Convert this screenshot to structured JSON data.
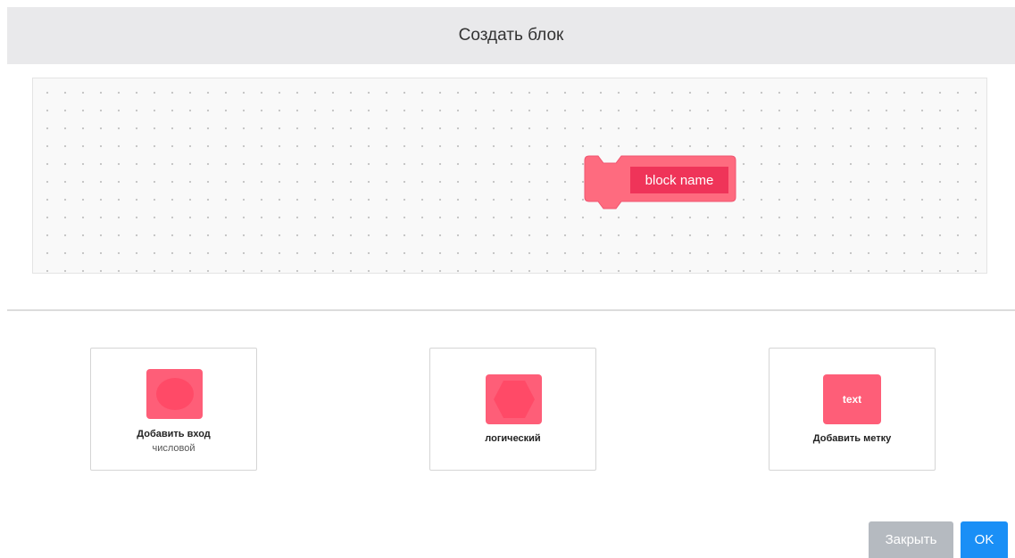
{
  "dialog": {
    "title": "Создать блок"
  },
  "workspace": {
    "block_name": "block name"
  },
  "options": [
    {
      "icon": "oval-icon",
      "label": "Добавить вход",
      "sublabel": "числовой"
    },
    {
      "icon": "diamond-icon",
      "label": "логический"
    },
    {
      "icon": "text-icon",
      "icon_text": "text",
      "label": "Добавить метку"
    }
  ],
  "buttons": {
    "close_label": "Закрыть",
    "ok_label": "OK"
  },
  "colors": {
    "block_fill": "#fe6b7f",
    "block_field": "#ef3459",
    "icon_fill": "#fe5e78",
    "ok_button": "#1a8ff6",
    "close_button": "#b5bac0"
  }
}
